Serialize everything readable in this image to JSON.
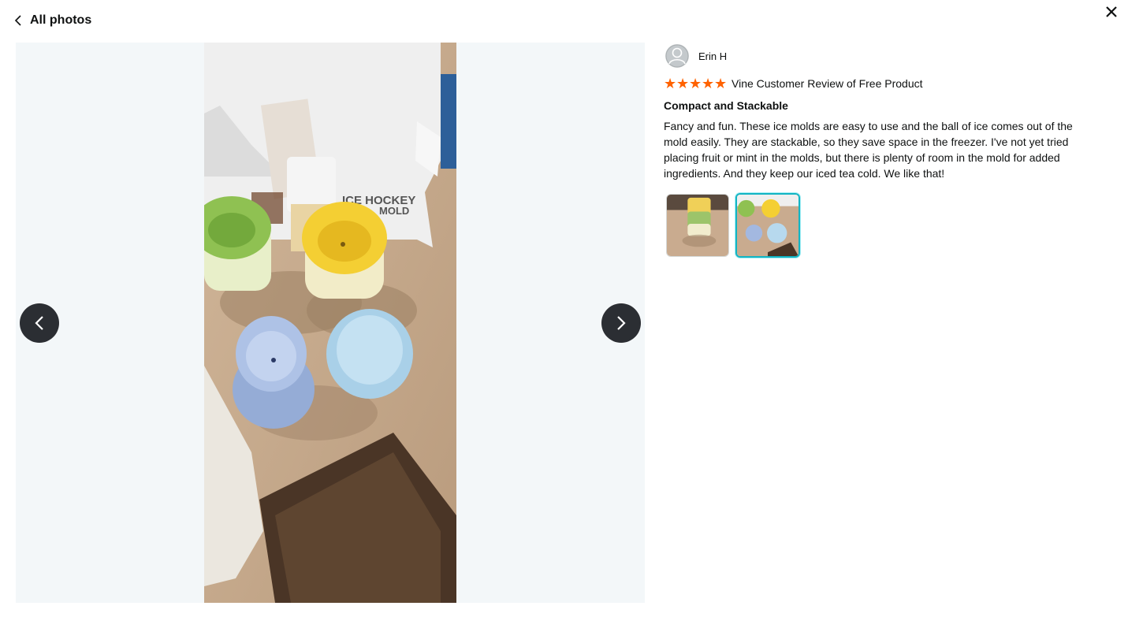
{
  "header": {
    "back_label": "All photos"
  },
  "review": {
    "reviewer_name": "Erin H",
    "rating": 5,
    "rating_max": 5,
    "badge": "Vine Customer Review of Free Product",
    "title": "Compact and Stackable",
    "body": "Fancy and fun. These ice molds are easy to use and the ball of ice comes out of the mold easily. They are stackable, so they save space in the freezer. I've not yet tried placing fruit or mint in the molds, but there is plenty of room in the mold for added ingredients. And they keep our iced tea cold. We like that!"
  },
  "photo": {
    "box_text": "ICE HOCKEY MOLD"
  },
  "thumbnails": [
    {
      "icon": "stacked-molds-thumbnail",
      "active": false
    },
    {
      "icon": "four-molds-thumbnail",
      "active": true
    }
  ],
  "colors": {
    "star": "#ff6200",
    "active_thumb_border": "#12b4c3",
    "nav_button": "#2b2e33",
    "viewer_bg": "#f3f7f9"
  }
}
